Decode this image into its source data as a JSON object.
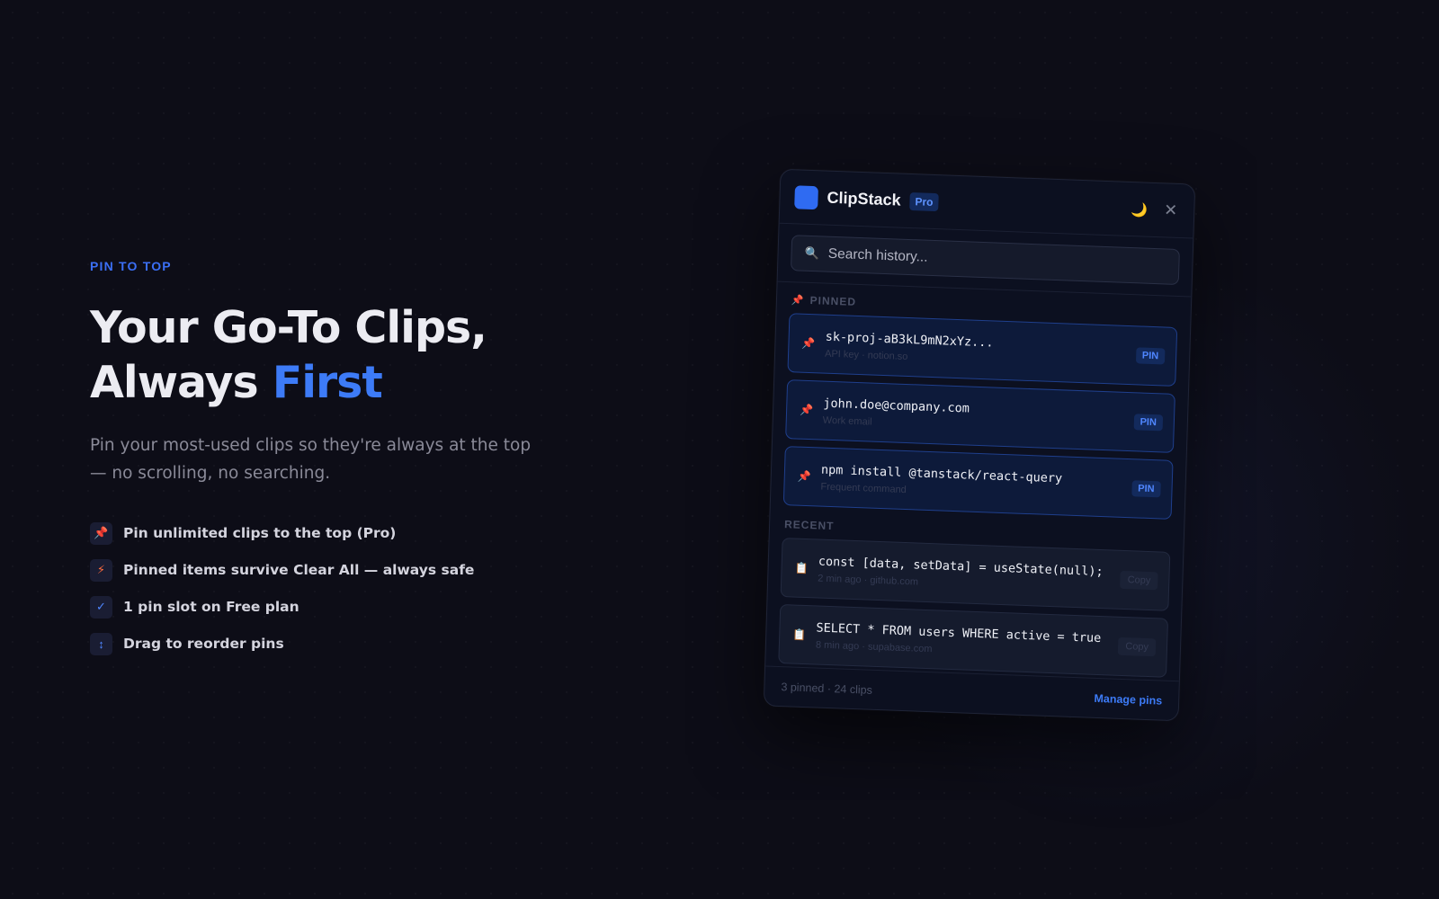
{
  "hero": {
    "eyebrow": "PIN TO TOP",
    "headline_line1": "Your Go-To Clips,",
    "headline_line2_prefix": "Always ",
    "headline_accent": "First",
    "subtitle": "Pin your most-used clips so they're always at the top — no scrolling, no searching.",
    "features": [
      {
        "icon": "pin-icon",
        "text": "Pin unlimited clips to the top (Pro)"
      },
      {
        "icon": "bolt-icon",
        "text": "Pinned items survive Clear All — always safe"
      },
      {
        "icon": "check-icon",
        "text": "1 pin slot on Free plan"
      },
      {
        "icon": "reorder-arrows-icon",
        "text": "Drag to reorder pins"
      }
    ]
  },
  "app": {
    "name": "ClipStack",
    "badge": "Pro",
    "search_placeholder": "Search history...",
    "pinned_label": "PINNED",
    "recent_label": "RECENT",
    "pinned": [
      {
        "text": "sk-proj-aB3kL9mN2xYz...",
        "meta": "API key · notion.so",
        "tag": "PIN"
      },
      {
        "text": "john.doe@company.com",
        "meta": "Work email",
        "tag": "PIN"
      },
      {
        "text": "npm install @tanstack/react-query",
        "meta": "Frequent command",
        "tag": "PIN"
      }
    ],
    "recent": [
      {
        "text": "const [data, setData] = useState(null);",
        "meta": "2 min ago · github.com",
        "action": "Copy"
      },
      {
        "text": "SELECT * FROM users WHERE active = true",
        "meta": "8 min ago · supabase.com",
        "action": "Copy"
      }
    ],
    "footer_stats": "3 pinned · 24 clips",
    "footer_link": "Manage pins"
  },
  "colors": {
    "background": "#0d0d17",
    "accent": "#3d7bf7",
    "pin": "#f2406b"
  }
}
